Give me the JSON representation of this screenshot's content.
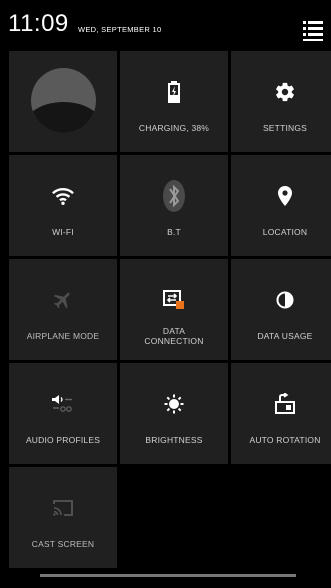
{
  "status": {
    "time": "11:09",
    "date": "WED, SEPTEMBER 10"
  },
  "header": {
    "menu_icon": "settings-list-icon"
  },
  "tiles": {
    "charging": {
      "label": "CHARGING, 38%",
      "icon": "battery-charging-icon",
      "level": 0.38
    },
    "settings": {
      "label": "SETTINGS",
      "icon": "gear-icon"
    },
    "wifi": {
      "label": "WI-FI",
      "icon": "wifi-icon"
    },
    "bt": {
      "label": "B.T",
      "icon": "bluetooth-icon"
    },
    "location": {
      "label": "LOCATION",
      "icon": "location-pin-icon"
    },
    "airplane": {
      "label": "AIRPLANE MODE",
      "icon": "airplane-icon"
    },
    "data_connection": {
      "label": "DATA CONNECTION",
      "line1": "DATA",
      "line2": "CONNECTION",
      "icon": "sim-data-icon"
    },
    "data_usage": {
      "label": "DATA USAGE",
      "icon": "pie-usage-icon"
    },
    "audio_profiles": {
      "label": "AUDIO PROFILES",
      "icon": "audio-profile-icon"
    },
    "brightness": {
      "label": "BRIGHTNESS",
      "icon": "sun-icon"
    },
    "auto_rotation": {
      "label": "AUTO ROTATION",
      "icon": "rotation-icon"
    },
    "cast_screen": {
      "label": "CAST SCREEN",
      "icon": "cast-icon"
    }
  },
  "colors": {
    "background": "#000000",
    "tile": "#202020",
    "text": "#d0d0d0",
    "icon_active": "#ffffff",
    "icon_inactive": "#555555",
    "accent_orange": "#e8731a"
  }
}
